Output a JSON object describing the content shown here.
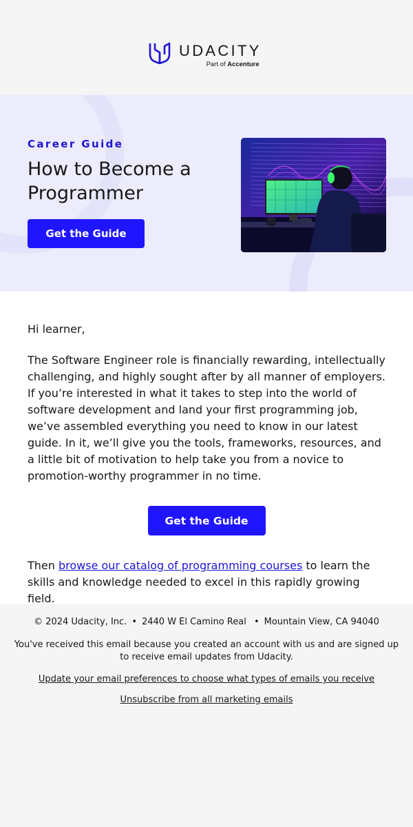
{
  "header": {
    "brand_name": "UDACITY",
    "brand_sub_prefix": "Part of",
    "brand_sub_company": "Accenture",
    "logo_icon": "udacity-u-logo",
    "brand_color": "#2015ff"
  },
  "hero": {
    "eyebrow": "Career Guide",
    "title": "How to Become a Programmer",
    "button_label": "Get the Guide",
    "image_alt": "Programmer wearing headphones working at a computer in a neon-lit room",
    "background_color": "#ececfd"
  },
  "body": {
    "greeting": "Hi learner,",
    "paragraph": "The Software Engineer role is financially rewarding, intellectually challenging, and highly sought after by all manner of employers. If you’re interested in what it takes to step into the world of software development and land your first programming job, we’ve assembled everything you need to know in our latest guide. In it, we’ll give you the tools, frameworks, resources, and a little bit of motivation to help take you from a novice to promotion-worthy programmer in no time.",
    "cta_label": "Get the Guide",
    "closing_prefix": "Then ",
    "closing_link": "browse our catalog of programming courses",
    "closing_suffix": " to learn the skills and knowledge needed to excel in this rapidly growing field."
  },
  "footer": {
    "copyright": "© 2024 Udacity, Inc.",
    "separator": "•",
    "address": "2440 W El Camino Real",
    "city": "Mountain View, CA 94040",
    "notice": "You've received this email because you created an account with us and are signed up to receive email updates from Udacity.",
    "preferences_link": "Update your email preferences to choose what types of emails you receive",
    "unsubscribe_link": "Unsubscribe from all marketing emails"
  }
}
